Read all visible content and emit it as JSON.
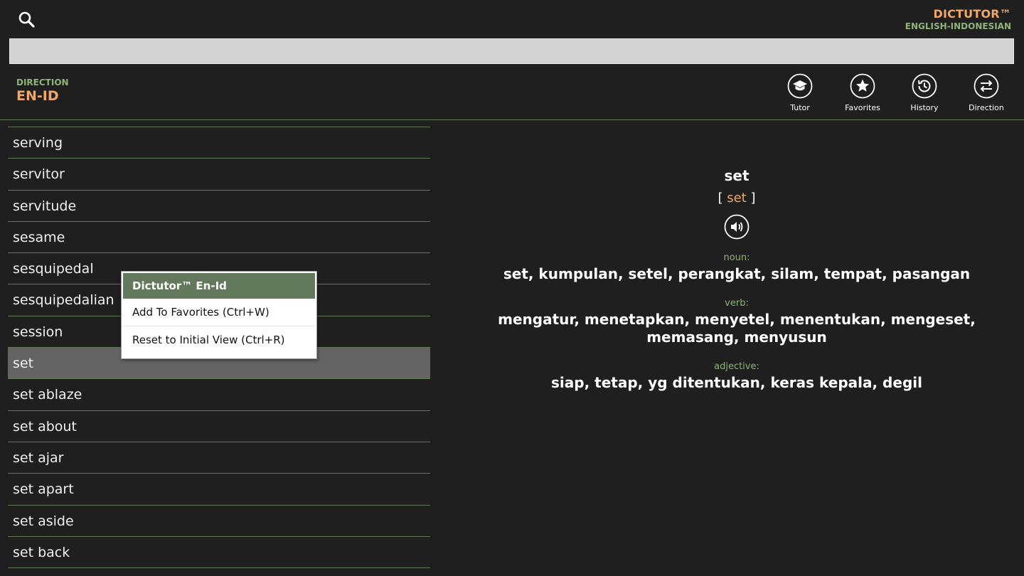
{
  "app": {
    "title": "DICTUTOR™",
    "subtitle": "ENGLISH-INDONESIAN"
  },
  "search": {
    "value": "",
    "placeholder": ""
  },
  "direction": {
    "label": "DIRECTION",
    "value": "EN-ID"
  },
  "toolbar": {
    "tutor_label": "Tutor",
    "favorites_label": "Favorites",
    "history_label": "History",
    "direction_label": "Direction"
  },
  "word_list": [
    {
      "word": "serving"
    },
    {
      "word": "servitor"
    },
    {
      "word": "servitude"
    },
    {
      "word": "sesame"
    },
    {
      "word": "sesquipedal"
    },
    {
      "word": "sesquipedalian"
    },
    {
      "word": "session"
    },
    {
      "word": "set",
      "selected": true
    },
    {
      "word": "set ablaze"
    },
    {
      "word": "set about"
    },
    {
      "word": "set ajar"
    },
    {
      "word": "set apart"
    },
    {
      "word": "set aside"
    },
    {
      "word": "set back"
    }
  ],
  "context_menu": {
    "header": "Dictutor™ En-Id",
    "items": [
      "Add To Favorites (Ctrl+W)",
      "Reset to Initial View (Ctrl+R)"
    ]
  },
  "entry": {
    "word": "set",
    "pronunciation_open": "[",
    "pronunciation": "set",
    "pronunciation_close": "]",
    "senses": [
      {
        "pos": "noun:",
        "meaning": "set, kumpulan, setel, perangkat, silam, tempat, pasangan"
      },
      {
        "pos": "verb:",
        "meaning": "mengatur, menetapkan, menyetel, menentukan, mengeset, memasang, menyusun"
      },
      {
        "pos": "adjective:",
        "meaning": "siap, tetap, yg ditentukan, keras kepala, degil"
      }
    ]
  },
  "colors": {
    "background": "#1f1f1f",
    "accent_orange": "#f0a868",
    "accent_green": "#8fb37a",
    "divider": "#5e7a54",
    "selected_row": "#636363",
    "menu_header": "#627a5b"
  }
}
